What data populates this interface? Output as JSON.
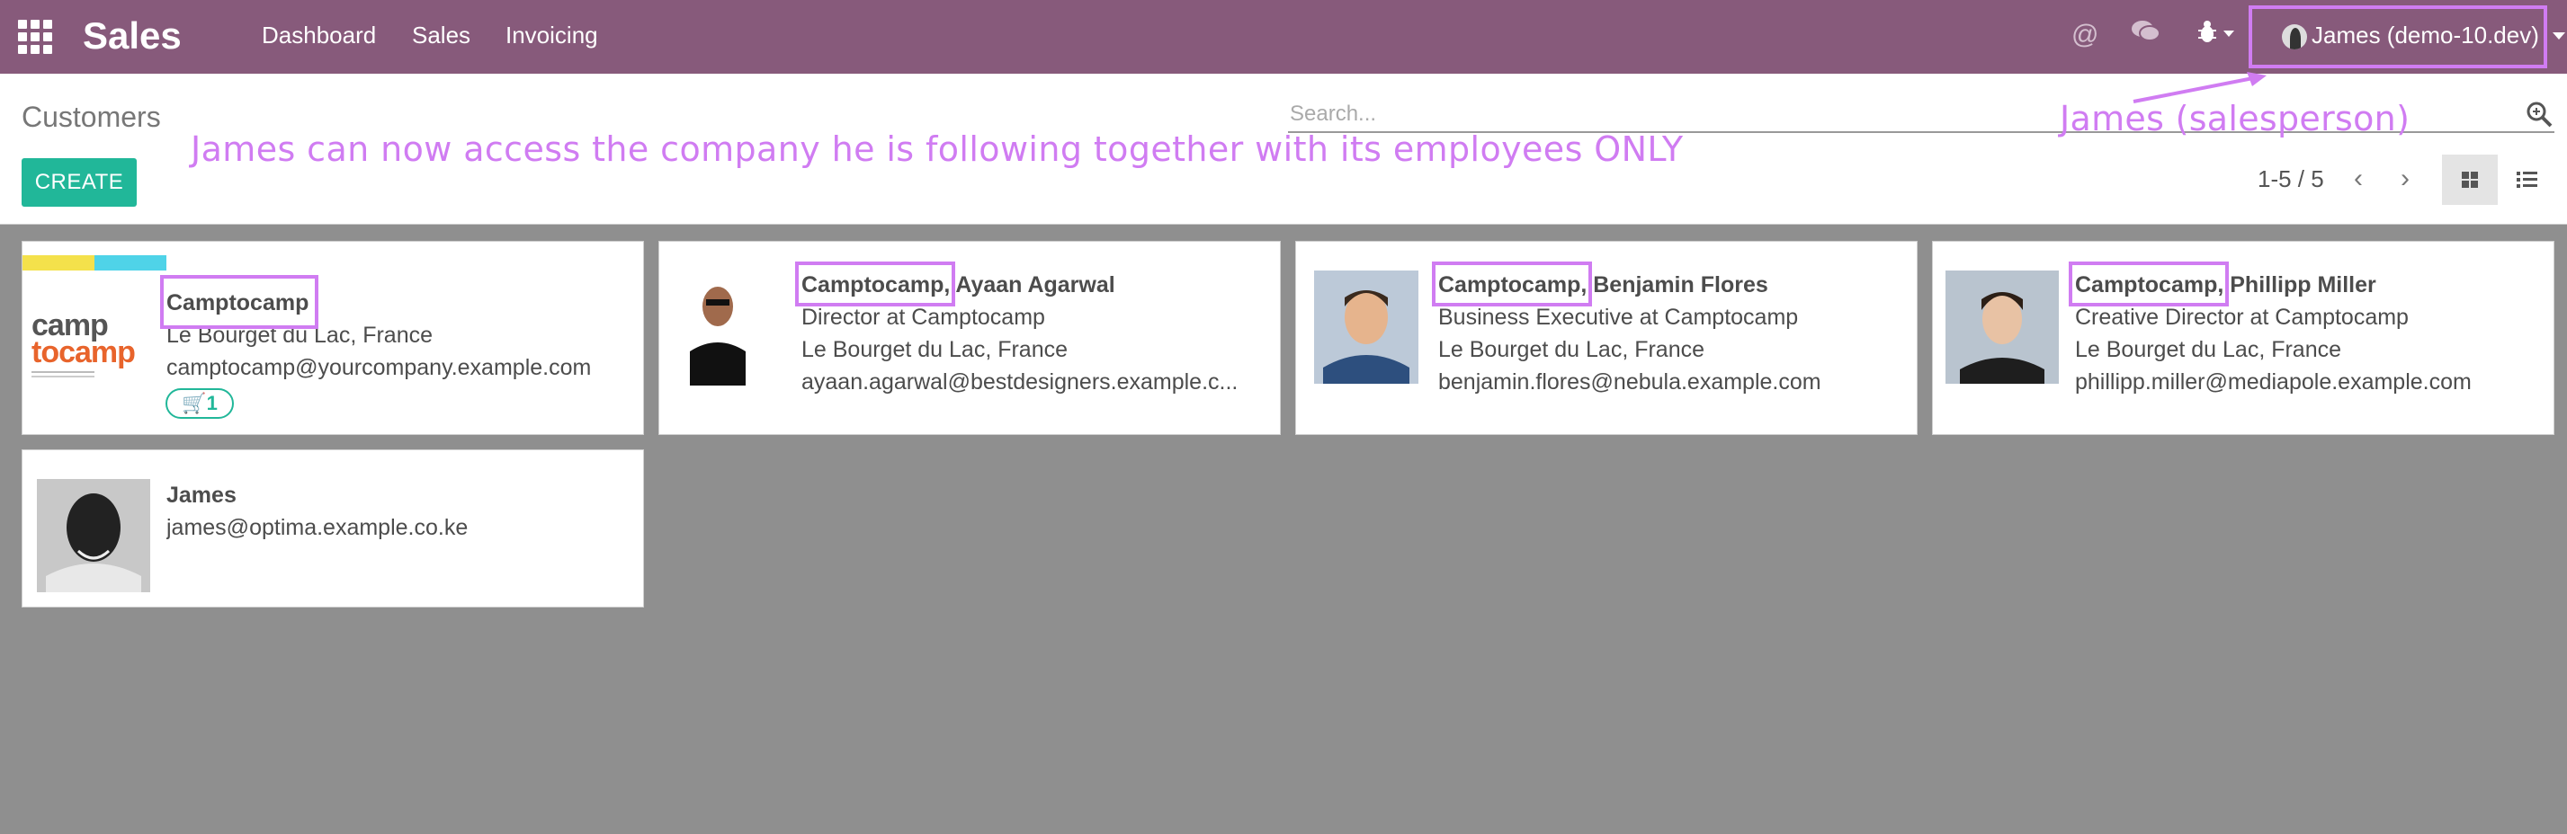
{
  "topbar": {
    "app_title": "Sales",
    "menu": [
      "Dashboard",
      "Sales",
      "Invoicing"
    ],
    "user": "James (demo-10.dev)",
    "icons": [
      "apps-icon",
      "at-icon",
      "chat-icon",
      "bug-icon"
    ]
  },
  "control": {
    "breadcrumb": "Customers",
    "create_label": "CREATE",
    "search_placeholder": "Search...",
    "pager": "1-5 / 5"
  },
  "annotations": {
    "main": "James can now access the company he is following together with its employees ONLY",
    "salesperson": "James (salesperson)",
    "color": "#d07cf2"
  },
  "cards": [
    {
      "name": "Camptocamp",
      "lines": [
        "Le Bourget du Lac, France",
        "camptocamp@yourcompany.example.com"
      ],
      "badge": "1"
    },
    {
      "name": "Camptocamp, Ayaan Agarwal",
      "lines": [
        "Director at Camptocamp",
        "Le Bourget du Lac, France",
        "ayaan.agarwal@bestdesigners.example.c..."
      ]
    },
    {
      "name": "Camptocamp, Benjamin Flores",
      "lines": [
        "Business Executive at Camptocamp",
        "Le Bourget du Lac, France",
        "benjamin.flores@nebula.example.com"
      ]
    },
    {
      "name": "Camptocamp, Phillipp Miller",
      "lines": [
        "Creative Director at Camptocamp",
        "Le Bourget du Lac, France",
        "phillipp.miller@mediapole.example.com"
      ]
    },
    {
      "name": "James",
      "lines": [
        "james@optima.example.co.ke"
      ]
    }
  ],
  "logo": {
    "line1": "camp",
    "line2": "tocamp"
  },
  "colors": {
    "topbar": "#875a7b",
    "create": "#21b799",
    "background": "#8f8f8f"
  }
}
